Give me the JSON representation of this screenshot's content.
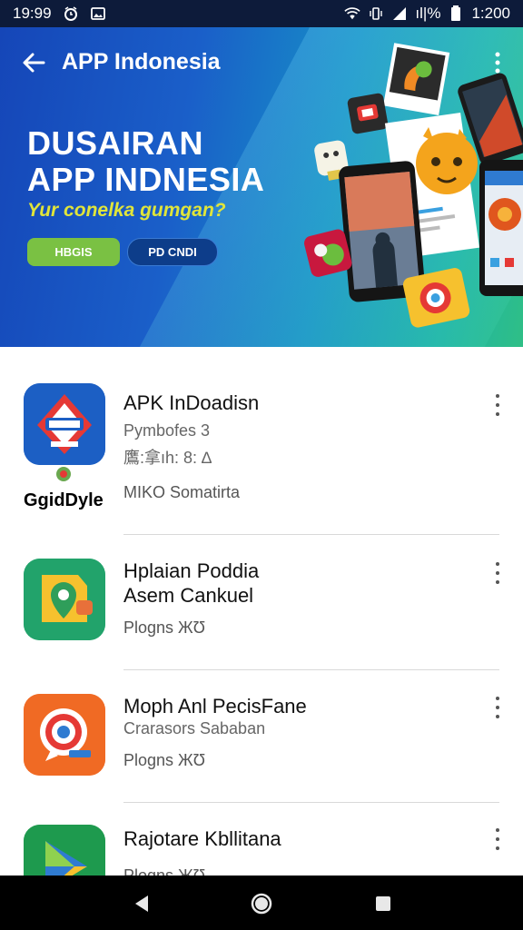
{
  "status_bar": {
    "time": "19:99",
    "signal_text": "ıl|%",
    "battery_time": "1:200"
  },
  "header": {
    "title": "APP Indonesia"
  },
  "hero": {
    "headline_line1": "DUSAIRAN",
    "headline_line2": "APP INDNESIA",
    "subtitle": "Yur conelka gumgan?",
    "primary_button": "HBGIS",
    "secondary_button": "PD CNDI"
  },
  "apps": [
    {
      "title": "APK InDoadisn",
      "line1": "Pymbofes 3",
      "line2": "鷹:拿ıh: 8: ∆",
      "meta": "MIKO Somatirta",
      "brand": "GgidDyle"
    },
    {
      "title_line1": "Hplaian Poddia",
      "title_line2": "Asem Cankuel",
      "meta": "Plogns ЖƱ"
    },
    {
      "title": "Moph Anl PecisFane",
      "line1": "Crarasors Sababan",
      "meta": "Plogns ЖƱ"
    },
    {
      "title": "Rajotare Kbllitana",
      "meta": "Plogns ЖƱ"
    }
  ],
  "colors": {
    "hero_gradient_start": "#1546b8",
    "hero_gradient_end": "#2fbf86",
    "accent_yellow": "#e0e53a",
    "primary_green": "#7ac143",
    "secondary_blue": "#0d3d8a"
  },
  "icons": {
    "back": "arrow-left",
    "more": "vertical-dots",
    "nav_back": "triangle-left",
    "nav_home": "circle",
    "nav_recents": "square"
  }
}
